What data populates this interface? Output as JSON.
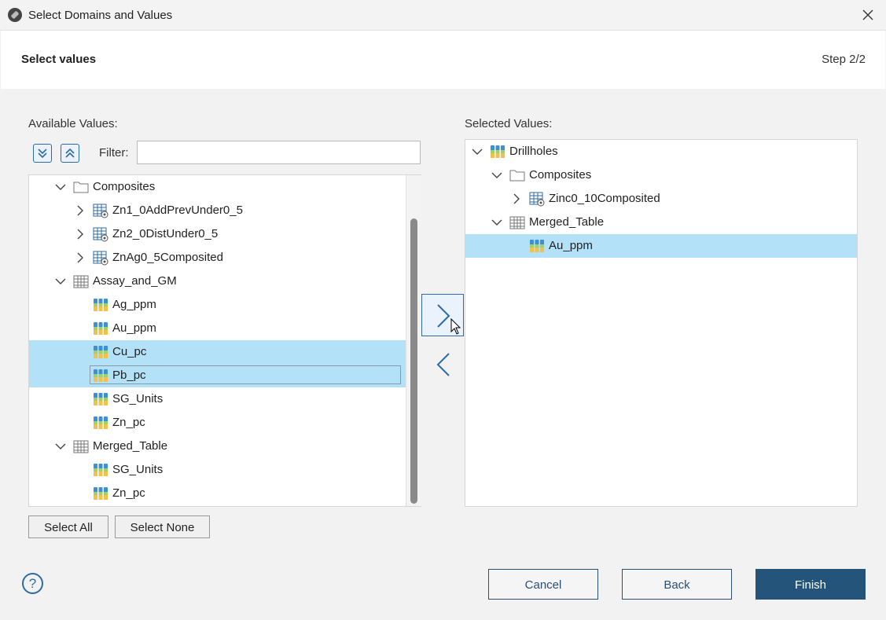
{
  "window": {
    "title": "Select Domains and Values",
    "close_icon": "close-icon"
  },
  "header": {
    "title": "Select values",
    "step": "Step 2/2"
  },
  "available": {
    "label": "Available Values:",
    "filter_label": "Filter:",
    "filter_value": "",
    "expand_all_icon": "expand-all-icon",
    "collapse_all_icon": "collapse-all-icon",
    "rows": [
      {
        "text": "Composites",
        "level": 0,
        "chev": "down",
        "icon": "folder",
        "selected": false
      },
      {
        "text": "Zn1_0AddPrevUnder0_5",
        "level": 1,
        "chev": "right",
        "icon": "table",
        "selected": false
      },
      {
        "text": "Zn2_0DistUnder0_5",
        "level": 1,
        "chev": "right",
        "icon": "table",
        "selected": false
      },
      {
        "text": "ZnAg0_5Composited",
        "level": 1,
        "chev": "right",
        "icon": "table",
        "selected": false
      },
      {
        "text": "Assay_and_GM",
        "level": 0,
        "chev": "down",
        "icon": "merged",
        "selected": false
      },
      {
        "text": "Ag_ppm",
        "level": 1,
        "chev": "",
        "icon": "value",
        "selected": false
      },
      {
        "text": "Au_ppm",
        "level": 1,
        "chev": "",
        "icon": "value",
        "selected": false
      },
      {
        "text": "Cu_pc",
        "level": 1,
        "chev": "",
        "icon": "value",
        "selected": true
      },
      {
        "text": "Pb_pc",
        "level": 1,
        "chev": "",
        "icon": "value",
        "selected": true,
        "focused": true
      },
      {
        "text": "SG_Units",
        "level": 1,
        "chev": "",
        "icon": "value",
        "selected": false
      },
      {
        "text": "Zn_pc",
        "level": 1,
        "chev": "",
        "icon": "value",
        "selected": false
      },
      {
        "text": "Merged_Table",
        "level": 0,
        "chev": "down",
        "icon": "merged",
        "selected": false
      },
      {
        "text": "SG_Units",
        "level": 1,
        "chev": "",
        "icon": "value",
        "selected": false
      },
      {
        "text": "Zn_pc",
        "level": 1,
        "chev": "",
        "icon": "value",
        "selected": false
      }
    ],
    "select_all": "Select All",
    "select_none": "Select None"
  },
  "selected": {
    "label": "Selected Values:",
    "rows": [
      {
        "text": "Drillholes",
        "level": 0,
        "chev": "down",
        "icon": "value",
        "selected": false
      },
      {
        "text": "Composites",
        "level": 1,
        "chev": "down",
        "icon": "folder",
        "selected": false
      },
      {
        "text": "Zinc0_10Composited",
        "level": 2,
        "chev": "right",
        "icon": "table",
        "selected": false
      },
      {
        "text": "Merged_Table",
        "level": 1,
        "chev": "down",
        "icon": "merged",
        "selected": false
      },
      {
        "text": "Au_ppm",
        "level": 2,
        "chev": "",
        "icon": "value",
        "selected": true
      }
    ]
  },
  "move": {
    "add_icon": "chevron-right-icon",
    "remove_icon": "chevron-left-icon"
  },
  "footer": {
    "help_icon": "help-icon",
    "help_glyph": "?",
    "cancel": "Cancel",
    "back": "Back",
    "finish": "Finish"
  },
  "colors": {
    "accent": "#2f6aa3",
    "selection": "#b3e1f7",
    "primary_button": "#245479"
  }
}
